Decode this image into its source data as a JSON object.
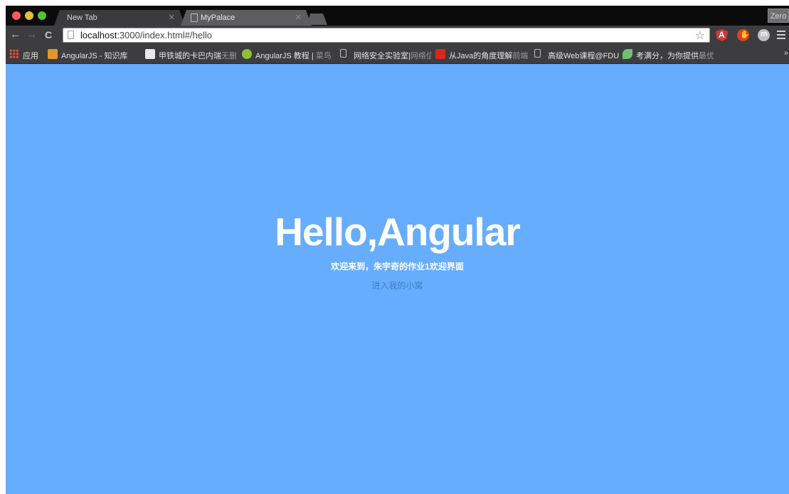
{
  "browser": {
    "tabs": [
      {
        "title": "New Tab",
        "close": "✕",
        "active": false
      },
      {
        "title": "MyPalace",
        "close": "✕",
        "active": true
      }
    ],
    "profile_button": "Zero",
    "address": {
      "host": "localhost",
      "rest": ":3000/index.html#/hello"
    },
    "star": "☆",
    "nav": {
      "back": "←",
      "forward": "→",
      "reload": "C"
    },
    "extensions": [
      {
        "name": "angular-batarang-icon",
        "glyph": "A"
      },
      {
        "name": "adblock-icon",
        "glyph": "✋"
      },
      {
        "name": "profile-m-icon",
        "glyph": "m"
      }
    ],
    "bookmarks": [
      {
        "label": "应用",
        "icon": "apps-grid-icon"
      },
      {
        "label": "AngularJS - 知识库",
        "faded": " - ",
        "icon": "csdn-icon"
      },
      {
        "label": "甲铁城的卡巴内瑞",
        "faded": "无删",
        "icon": "face-icon"
      },
      {
        "label": "AngularJS 教程 | ",
        "faded": "菜鸟",
        "icon": "runoob-icon"
      },
      {
        "label": "网络安全实验室|",
        "faded": "网络信",
        "icon": "page-icon"
      },
      {
        "label": "从Java的角度理解",
        "faded": "前端",
        "icon": "c-icon"
      },
      {
        "label": "高级Web课程@FDU",
        "icon": "page-icon"
      },
      {
        "label": "考满分，为你提供",
        "faded": "最优",
        "icon": "leaf-icon"
      }
    ],
    "bookmarks_more": "»"
  },
  "page": {
    "title": "Hello,Angular",
    "subtitle": "欢迎来到，朱宇奇的作业1欢迎界面",
    "link": "进入我的小窝"
  }
}
